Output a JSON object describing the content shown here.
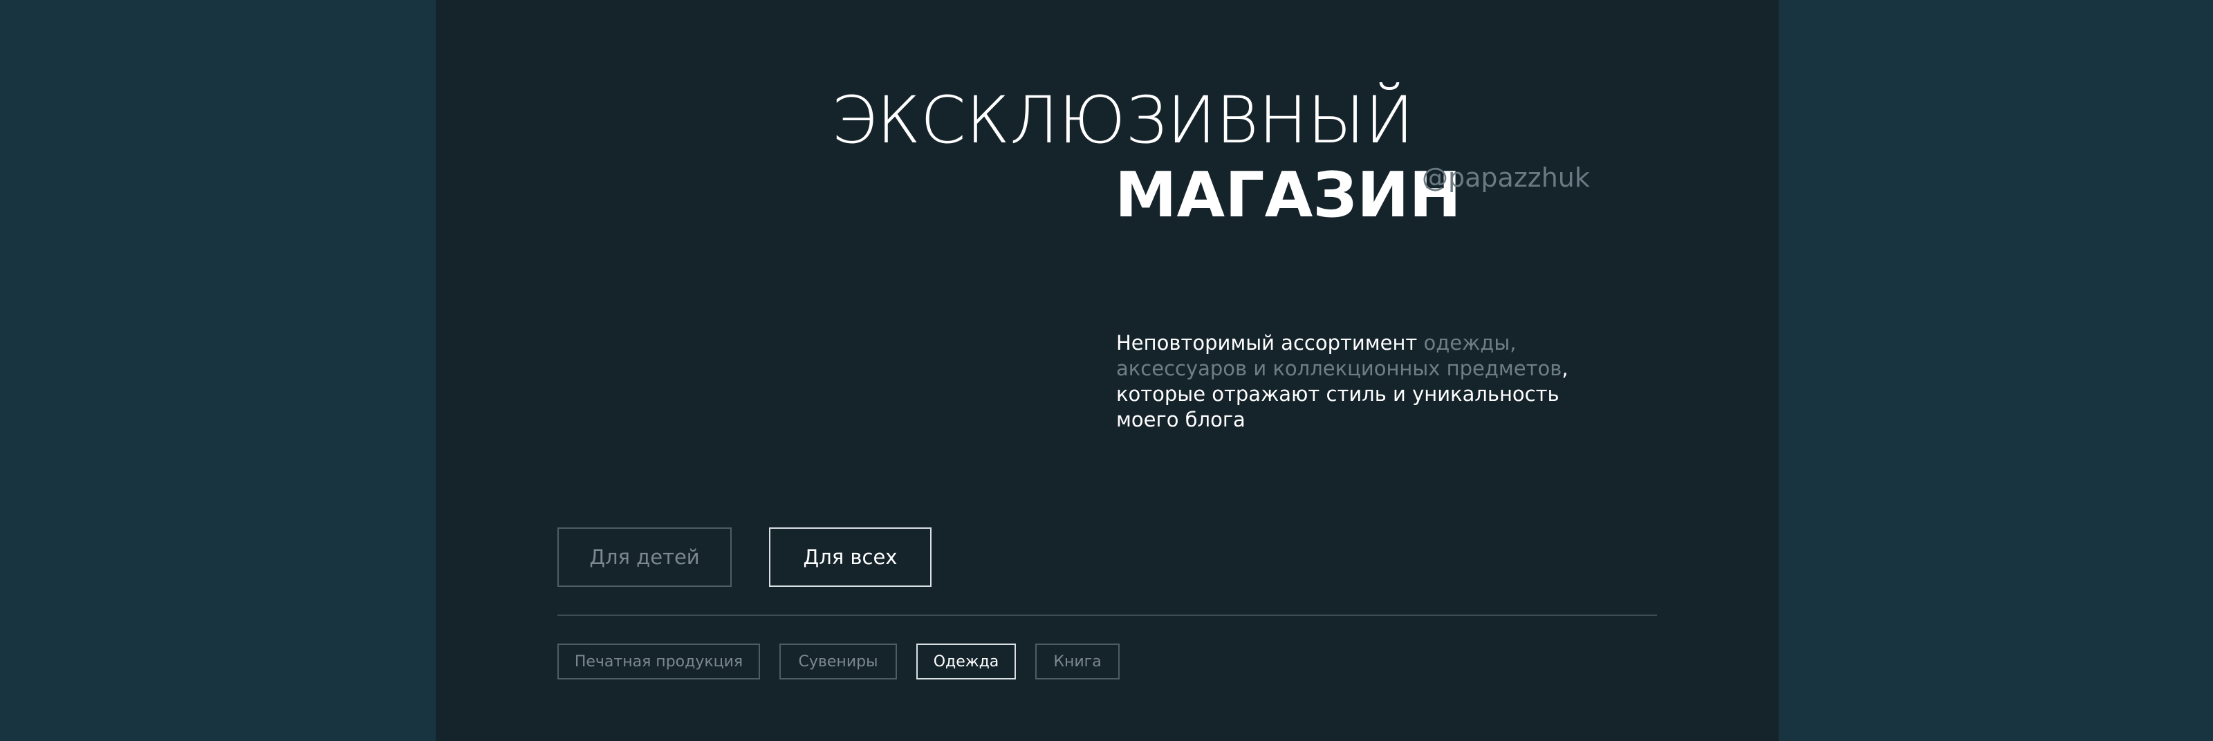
{
  "hero": {
    "title_line_1": "ЭКСКЛЮЗИВНЫЙ",
    "title_line_2": "МАГАЗИН",
    "handle": "@papazzhuk"
  },
  "description": {
    "part_1": "Неповторимый ассортимент ",
    "part_2_muted": "одежды, аксессуаров и коллекционных предметов",
    "part_3": ", которые отражают стиль и уникальность моего блога"
  },
  "audience_filter": {
    "items": [
      {
        "label": "Для детей",
        "active": false
      },
      {
        "label": "Для всех",
        "active": true
      }
    ]
  },
  "category_filter": {
    "items": [
      {
        "label": "Печатная продукция",
        "active": false
      },
      {
        "label": "Сувениры",
        "active": false
      },
      {
        "label": "Одежда",
        "active": true
      },
      {
        "label": "Книга",
        "active": false
      }
    ]
  },
  "colors": {
    "outer_background": "#173440",
    "panel_background": "#15232b",
    "muted_text": "#6f7d85",
    "active_border": "#d9e0e4"
  }
}
